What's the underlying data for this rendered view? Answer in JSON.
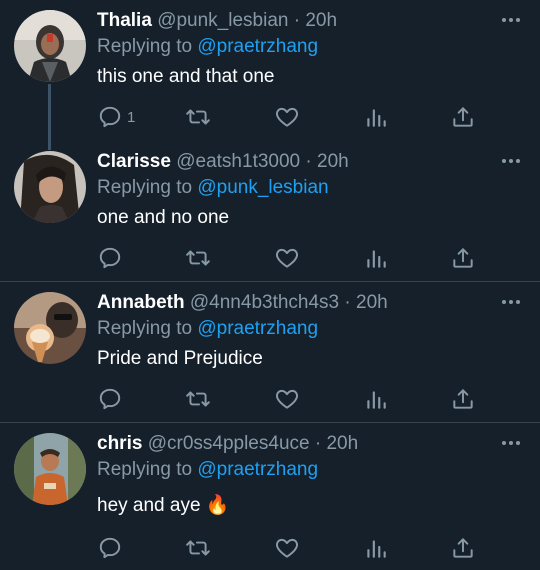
{
  "colors": {
    "background": "#15202b",
    "text": "#ffffff",
    "muted": "#8899a6",
    "link": "#1da1f2",
    "divider": "#38444d"
  },
  "replying_prefix": "Replying to",
  "tweets": [
    {
      "name": "Thalia",
      "handle": "@punk_lesbian",
      "separator": "·",
      "time": "20h",
      "replying_to": "@praetrzhang",
      "text": "this one and that one",
      "reply_count": "1"
    },
    {
      "name": "Clarisse",
      "handle": "@eatsh1t3000",
      "separator": "·",
      "time": "20h",
      "replying_to": "@punk_lesbian",
      "text": "one and no one",
      "reply_count": ""
    },
    {
      "name": "Annabeth",
      "handle": "@4nn4b3thch4s3",
      "separator": "·",
      "time": "20h",
      "replying_to": "@praetrzhang",
      "text": "Pride and Prejudice",
      "reply_count": ""
    },
    {
      "name": "chris",
      "handle": "@cr0ss4pples4uce",
      "separator": "·",
      "time": "20h",
      "replying_to": "@praetrzhang",
      "text": "hey and aye 🔥",
      "reply_count": ""
    }
  ]
}
